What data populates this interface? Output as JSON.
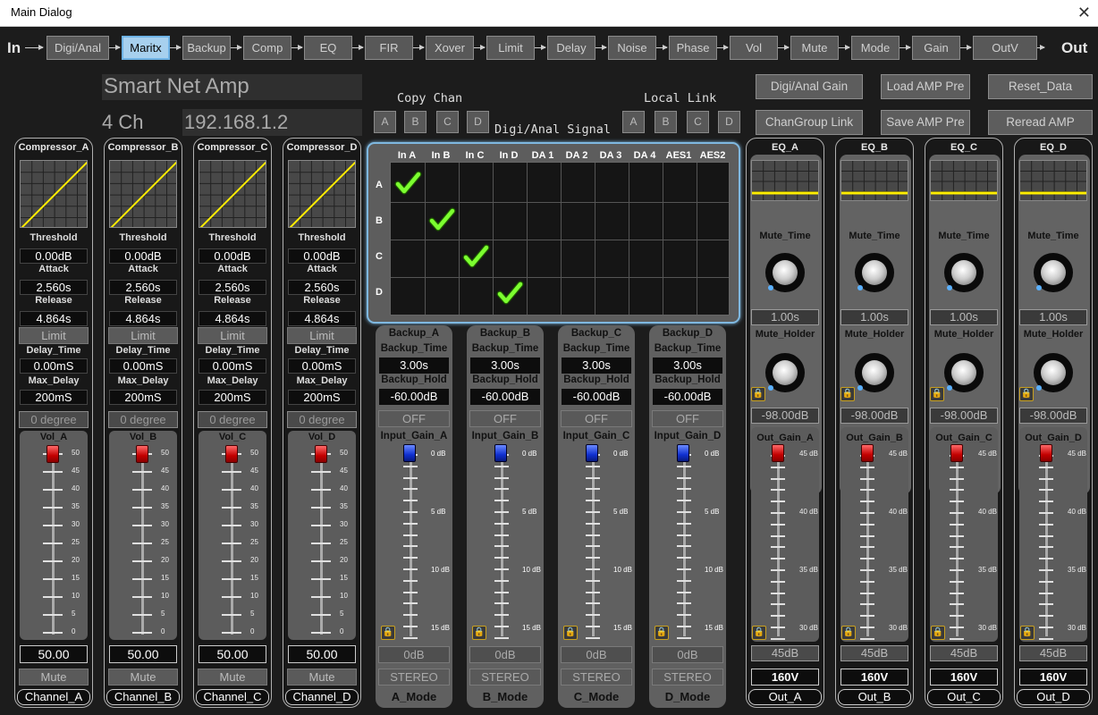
{
  "window": {
    "title": "Main Dialog"
  },
  "flow": {
    "start": "In",
    "end": "Out",
    "buttons": [
      "Digi/Anal",
      "Maritx",
      "Backup",
      "Comp",
      "EQ",
      "FIR",
      "Xover",
      "Limit",
      "Delay",
      "Noise",
      "Phase",
      "Vol",
      "Mute",
      "Mode",
      "Gain",
      "OutV"
    ],
    "active": "Maritx"
  },
  "device": {
    "name": "Smart Net Amp",
    "channels": "4 Ch",
    "ip": "192.168.1.2"
  },
  "copy_chan": {
    "label": "Copy Chan",
    "buttons": [
      "A",
      "B",
      "C",
      "D"
    ]
  },
  "local_link": {
    "label": "Local Link",
    "buttons": [
      "A",
      "B",
      "C",
      "D"
    ]
  },
  "matrix_label": "Digi/Anal Signal",
  "top_buttons": {
    "digi_anal_gain": "Digi/Anal Gain",
    "load_amp_pre": "Load AMP Pre",
    "reset_data": "Reset_Data",
    "changroup_link": "ChanGroup Link",
    "save_amp_pre": "Save AMP Pre",
    "reread_amp": "Reread AMP"
  },
  "compressors": [
    {
      "title": "Compressor_A",
      "threshold": "0.00dB",
      "attack": "2.560s",
      "release": "4.864s",
      "delay_time": "0.00mS",
      "max_delay": "200mS",
      "vol_label": "Vol_A",
      "vol_level": 0.5,
      "vol_value": "50.00",
      "channel": "Channel_A"
    },
    {
      "title": "Compressor_B",
      "threshold": "0.00dB",
      "attack": "2.560s",
      "release": "4.864s",
      "delay_time": "0.00mS",
      "max_delay": "200mS",
      "vol_label": "Vol_B",
      "vol_level": 0.5,
      "vol_value": "50.00",
      "channel": "Channel_B"
    },
    {
      "title": "Compressor_C",
      "threshold": "0.00dB",
      "attack": "2.560s",
      "release": "4.864s",
      "delay_time": "0.00mS",
      "max_delay": "200mS",
      "vol_label": "Vol_C",
      "vol_level": 0.5,
      "vol_value": "50.00",
      "channel": "Channel_C"
    },
    {
      "title": "Compressor_D",
      "threshold": "0.00dB",
      "attack": "2.560s",
      "release": "4.864s",
      "delay_time": "0.00mS",
      "max_delay": "200mS",
      "vol_label": "Vol_D",
      "vol_level": 0.5,
      "vol_value": "50.00",
      "channel": "Channel_D"
    }
  ],
  "comp_labels": {
    "threshold": "Threshold",
    "attack": "Attack",
    "release": "Release",
    "limit": "Limit",
    "delay_time": "Delay_Time",
    "max_delay": "Max_Delay",
    "degree": "0 degree",
    "mute": "Mute"
  },
  "vol_scale": [
    "50",
    "45",
    "40",
    "35",
    "30",
    "25",
    "20",
    "15",
    "10",
    "5",
    "0"
  ],
  "matrix": {
    "columns": [
      "In A",
      "In B",
      "In C",
      "In D",
      "DA 1",
      "DA 2",
      "DA 3",
      "DA 4",
      "AES1",
      "AES2"
    ],
    "rows": [
      "A",
      "B",
      "C",
      "D"
    ],
    "checked": [
      [
        0,
        0
      ],
      [
        1,
        1
      ],
      [
        2,
        2
      ],
      [
        3,
        3
      ]
    ]
  },
  "backups": [
    {
      "title": "Backup_A",
      "backup_time": "3.00s",
      "backup_hold": "-60.00dB",
      "state": "OFF",
      "gain_label": "Input_Gain_A",
      "gain_value": "0dB",
      "mode_value": "STEREO",
      "mode": "A_Mode"
    },
    {
      "title": "Backup_B",
      "backup_time": "3.00s",
      "backup_hold": "-60.00dB",
      "state": "OFF",
      "gain_label": "Input_Gain_B",
      "gain_value": "0dB",
      "mode_value": "STEREO",
      "mode": "B_Mode"
    },
    {
      "title": "Backup_C",
      "backup_time": "3.00s",
      "backup_hold": "-60.00dB",
      "state": "OFF",
      "gain_label": "Input_Gain_C",
      "gain_value": "0dB",
      "mode_value": "STEREO",
      "mode": "C_Mode"
    },
    {
      "title": "Backup_D",
      "backup_time": "3.00s",
      "backup_hold": "-60.00dB",
      "state": "OFF",
      "gain_label": "Input_Gain_D",
      "gain_value": "0dB",
      "mode_value": "STEREO",
      "mode": "D_Mode"
    }
  ],
  "backup_labels": {
    "backup_time": "Backup_Time",
    "backup_hold": "Backup_Hold"
  },
  "input_scale": [
    "0 dB",
    "5 dB",
    "10 dB",
    "15 dB"
  ],
  "eqs": [
    {
      "title": "EQ_A",
      "mute_time": "1.00s",
      "mute_holder": "-98.00dB",
      "gain_label": "Out_Gain_A",
      "gain_value": "45dB",
      "volt": "160V",
      "out": "Out_A"
    },
    {
      "title": "EQ_B",
      "mute_time": "1.00s",
      "mute_holder": "-98.00dB",
      "gain_label": "Out_Gain_B",
      "gain_value": "45dB",
      "volt": "160V",
      "out": "Out_B"
    },
    {
      "title": "EQ_C",
      "mute_time": "1.00s",
      "mute_holder": "-98.00dB",
      "gain_label": "Out_Gain_C",
      "gain_value": "45dB",
      "volt": "160V",
      "out": "Out_C"
    },
    {
      "title": "EQ_D",
      "mute_time": "1.00s",
      "mute_holder": "-98.00dB",
      "gain_label": "Out_Gain_D",
      "gain_value": "45dB",
      "volt": "160V",
      "out": "Out_D"
    }
  ],
  "eq_labels": {
    "mute_time": "Mute_Time",
    "mute_holder": "Mute_Holder"
  },
  "out_scale": [
    "45 dB",
    "40 dB",
    "35 dB",
    "30 dB"
  ],
  "colors": {
    "accent": "#a7d0ee",
    "curve": "#ffee00",
    "check": "#7cff30",
    "fader_red": "#d00000",
    "fader_blue": "#1030d0",
    "lock": "#e0b020"
  }
}
